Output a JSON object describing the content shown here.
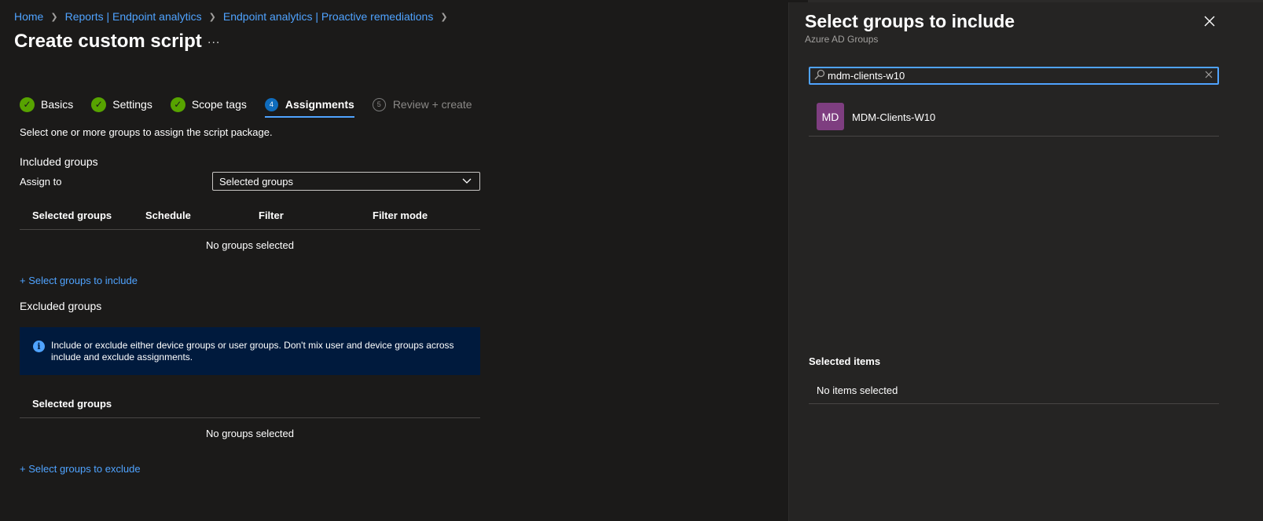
{
  "breadcrumb": {
    "items": [
      "Home",
      "Reports | Endpoint analytics",
      "Endpoint analytics | Proactive remediations"
    ],
    "separator": ">"
  },
  "page": {
    "title": "Create custom script",
    "more": "..."
  },
  "steps": [
    {
      "label": "Basics",
      "status": "complete",
      "number": "1"
    },
    {
      "label": "Settings",
      "status": "complete",
      "number": "2"
    },
    {
      "label": "Scope tags",
      "status": "complete",
      "number": "3"
    },
    {
      "label": "Assignments",
      "status": "active",
      "number": "4"
    },
    {
      "label": "Review + create",
      "status": "disabled",
      "number": "5"
    }
  ],
  "assignments": {
    "description": "Select one or more groups to assign the script package.",
    "included_heading": "Included groups",
    "assign_to_label": "Assign to",
    "assign_to_value": "Selected groups",
    "included_table": {
      "columns": [
        "Selected groups",
        "Schedule",
        "Filter",
        "Filter mode"
      ],
      "empty_text": "No groups selected"
    },
    "include_link": "+ Select groups to include",
    "excluded_heading": "Excluded groups",
    "info_text": "Include or exclude either device groups or user groups. Don't mix user and device groups across include and exclude assignments.",
    "excluded_table": {
      "columns": [
        "Selected groups"
      ],
      "empty_text": "No groups selected"
    },
    "exclude_link": "+ Select groups to exclude"
  },
  "panel": {
    "title": "Select groups to include",
    "subtitle": "Azure AD Groups",
    "search_value": "mdm-clients-w10",
    "results": [
      {
        "initials": "MD",
        "name": "MDM-Clients-W10",
        "avatar_color": "#7e3e80"
      }
    ],
    "selected_heading": "Selected items",
    "selected_empty": "No items selected"
  },
  "colors": {
    "background": "#1b1a19",
    "panel": "#252423",
    "link": "#4fa3ff",
    "check": "#57a300",
    "info_bg": "#001a3d"
  },
  "icons": {
    "step_complete": "checkmark-circle-icon",
    "info": "info-icon",
    "close": "close-icon",
    "search": "search-icon",
    "dropdown": "chevron-down-icon"
  }
}
